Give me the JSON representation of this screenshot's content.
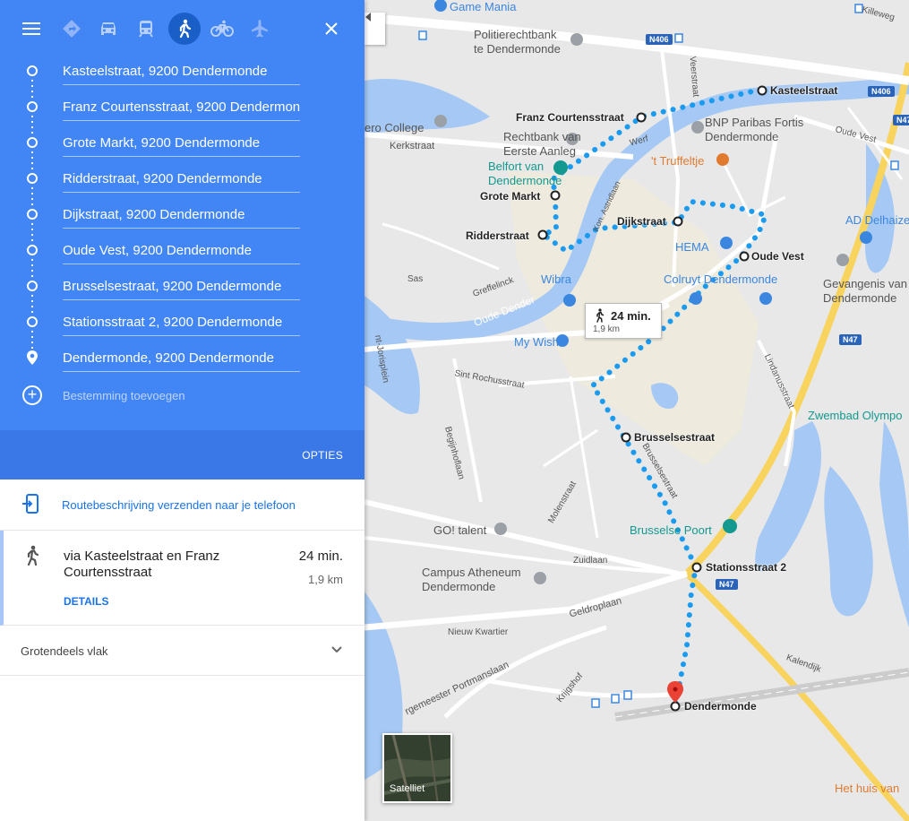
{
  "sidebar": {
    "modes": {
      "menu": "menu-icon",
      "best": "directions-icon",
      "car": "car-icon",
      "transit": "train-icon",
      "walking": "walk-icon",
      "bike": "bike-icon",
      "flight": "flight-icon",
      "close": "close-icon",
      "selected": "walking"
    },
    "waypoints": [
      "Kasteelstraat, 9200 Dendermonde",
      "Franz Courtensstraat, 9200 Dendermonde",
      "Grote Markt, 9200 Dendermonde",
      "Ridderstraat, 9200 Dendermonde",
      "Dijkstraat, 9200 Dendermonde",
      "Oude Vest, 9200 Dendermonde",
      "Brusselsestraat, 9200 Dendermonde",
      "Stationsstraat 2, 9200 Dendermonde",
      "Dendermonde, 9200 Dendermonde"
    ],
    "add_destination": "Bestemming toevoegen",
    "options_label": "OPTIES",
    "send_to_phone": "Routebeschrijving verzenden naar je telefoon",
    "route": {
      "via": "via Kasteelstraat en Franz Courtensstraat",
      "time": "24 min.",
      "distance": "1,9 km",
      "details_label": "DETAILS"
    },
    "terrain_note": "Grotendeels vlak"
  },
  "map": {
    "bubble": {
      "time": "24 min.",
      "distance": "1,9 km"
    },
    "stops": {
      "kasteelstraat": "Kasteelstraat",
      "franz": "Franz Courtensstraat",
      "grote_markt": "Grote Markt",
      "ridderstraat": "Ridderstraat",
      "dijkstraat": "Dijkstraat",
      "oude_vest": "Oude Vest",
      "brusselsestraat": "Brusselsestraat",
      "stationsstraat": "Stationsstraat 2",
      "dendermonde": "Dendermonde"
    },
    "pois": {
      "game_mania": "Game Mania",
      "politierechtbank_1": "Politierechtbank",
      "politierechtbank_2": "te Dendermonde",
      "college": "ero College",
      "rechtbank_1": "Rechtbank van",
      "rechtbank_2": "Eerste Aanleg",
      "belfort_1": "Belfort van",
      "belfort_2": "Dendermonde",
      "bnp_1": "BNP Paribas Fortis",
      "bnp_2": "Dendermonde",
      "truffeltje": "'t Truffeltje",
      "hema": "HEMA",
      "ad_delhaize": "AD Delhaize",
      "gevangenis_1": "Gevangenis van",
      "gevangenis_2": "Dendermonde",
      "colruyt": "Colruyt Dendermonde",
      "wibra": "Wibra",
      "my_wish": "My Wish",
      "zwembad": "Zwembad Olympo",
      "goi_talent": "GO! talent",
      "campus_1": "Campus Atheneum",
      "campus_2": "Dendermonde",
      "brusselse_poort": "Brusselse Poort",
      "huis_van": "Het huis van"
    },
    "streets": {
      "kerkstraat": "Kerkstraat",
      "werf": "Werf",
      "veerstraat": "Veerstraat",
      "oude_vest_st": "Oude Vest",
      "oude_dender": "Oude Dender",
      "greffelinck": "Greffelinck",
      "sas": "Sas",
      "sint_rochusstraat": "Sint Rochusstraat",
      "lindanusstraat": "Lindanusstraat",
      "begijnhoflaan": "Begijnhoflaan",
      "molenstraat": "Molenstraat",
      "zuidlaan": "Zuidlaan",
      "geldroplaan": "Geldroplaan",
      "nieuw_kwartier": "Nieuw Kwartier",
      "krijgshof": "Krijgshof",
      "portmanslaan": "rgemeester Portmanslaan",
      "kalendijk": "Kalendijk",
      "killeweg": "Killeweg",
      "brusselsestraat_st": "Brusselsestraat",
      "jorisplein": "nt-Jorisplein",
      "astridlaan": "Kon. Astridlaan"
    },
    "shields": {
      "n406a": "N406",
      "n406b": "N406",
      "n47a": "N47",
      "n47b": "N47",
      "n47c": "N47"
    },
    "satellite_label": "Satelliet"
  },
  "colors": {
    "panel_blue": "#4285f4",
    "route_blue": "#1a9bf0",
    "link_blue": "#1a73e8",
    "highway_yellow": "#f8d35e",
    "water": "#a5c9f4"
  }
}
